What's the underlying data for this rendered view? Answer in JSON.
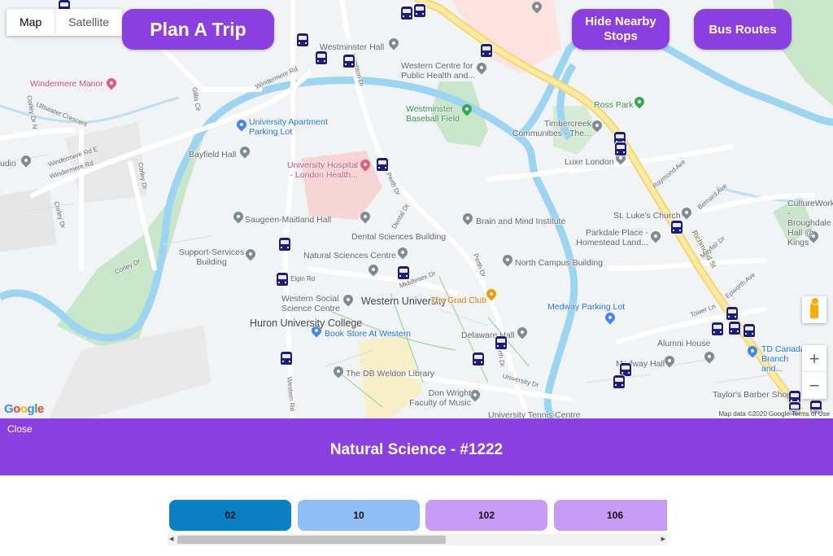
{
  "map": {
    "type_map": "Map",
    "type_satellite": "Satellite",
    "zoom_in": "+",
    "zoom_out": "−",
    "logo": "Google",
    "attribution": "Map data ©2020 Google   Terms of Use",
    "labels": {
      "windermere_manor": "Windermere Manor",
      "westminster_hall": "Westminster Hall",
      "western_centre": "Western Centre for Public Health and...",
      "westminster_baseball": "Westminster Baseball Field",
      "ross_park": "Ross Park",
      "timbercreek": "Timbercreek Communities - The...",
      "luxe_london": "Luxe London",
      "university_apartment": "University Apartment Parking Lot",
      "bayfield_hall": "Bayfield Hall",
      "university_hospital": "University Hospital - London Health...",
      "saugeen": "Saugeen-Maitland Hall",
      "brain_mind": "Brain and Mind Institute",
      "dental_sciences": "Dental Sciences Building",
      "st_lukes": "St. Luke's Church",
      "parkdale_place": "Parkdale Place - Homestead Land...",
      "support_services": "Support-Services Building",
      "natural_sciences": "Natural Sciences Centre",
      "north_campus": "North Campus Building",
      "culture_works": "CultureWorks - Broughdale Hall @ Kings",
      "western_social": "Western Social Science Centre",
      "western_university": "Western University",
      "grad_club": "The Grad Club",
      "medway_parking": "Medway Parking Lot",
      "huron": "Huron University College",
      "book_store": "Book Store At Western",
      "delaware_hall": "Delaware Hall",
      "alumni_house": "Alumni House",
      "td_canada": "TD Canada Branch and...",
      "db_weldon": "The DB Weldon Library",
      "medway_hall": "Medway Hall",
      "don_wright": "Don Wright Faculty of Music",
      "taylors": "Taylor's Barber Shop",
      "studio": "udio",
      "tennis": "University Tennis Centre",
      "st_windermere_rd_1": "Windermere Rd",
      "st_windermere_rd_2": "Windermere Rd",
      "st_windermere_rd_e": "Windermere Rd E",
      "st_ullswater": "Ullswater Crescent",
      "st_corley_1": "Corley Dr N",
      "st_corley_2": "Corley Dr",
      "st_corley_3": "Corley Dr",
      "st_corley_4": "Corley Dr",
      "st_lambton": "Lambton Dr",
      "st_perth_1": "Perth Dr",
      "st_perth_2": "Perth Dr",
      "st_perth_3": "Perth Dr",
      "st_dental": "Dental Dr",
      "st_middlesex": "Middlesex Dr",
      "st_elgin": "Elgin Rd",
      "st_western_rd": "Western Rd",
      "st_raymond": "Raymond Ave",
      "st_bernard": "Bernard Ave",
      "st_richmond": "Richmond St",
      "st_mayfair": "Mayfair Dr",
      "st_epworth": "Epworth Ave",
      "st_tower": "Tower Ln",
      "st_university_dr": "University Dr",
      "st_gillis": "Gillis Cir"
    }
  },
  "header": {
    "plan_trip": "Plan A Trip",
    "hide_stops": "Hide Nearby Stops",
    "bus_routes": "Bus Routes"
  },
  "panel": {
    "close": "Close",
    "title": "Natural Science - #1222",
    "color": "#8c3fe0"
  },
  "routes": [
    {
      "label": "02",
      "color": "#0a7fc4"
    },
    {
      "label": "10",
      "color": "#8fbef5"
    },
    {
      "label": "102",
      "color": "#c79bf6"
    },
    {
      "label": "106",
      "color": "#c79bf6"
    }
  ],
  "scroll": {
    "left_arrow": "◀",
    "right_arrow": "▶"
  }
}
